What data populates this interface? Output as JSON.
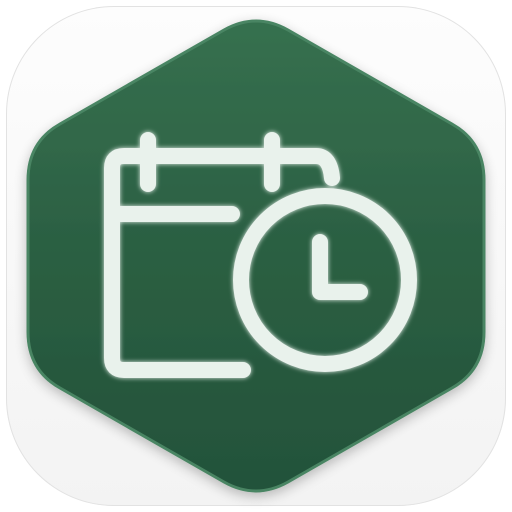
{
  "icon": {
    "name": "calendar-clock-icon",
    "shape": "hexagon",
    "colors": {
      "tile_background": "#f7f7f7",
      "hexagon_fill": "#2a5e41",
      "hexagon_edge": "#3f7a58",
      "glyph_stroke": "#ecf3ee"
    }
  }
}
